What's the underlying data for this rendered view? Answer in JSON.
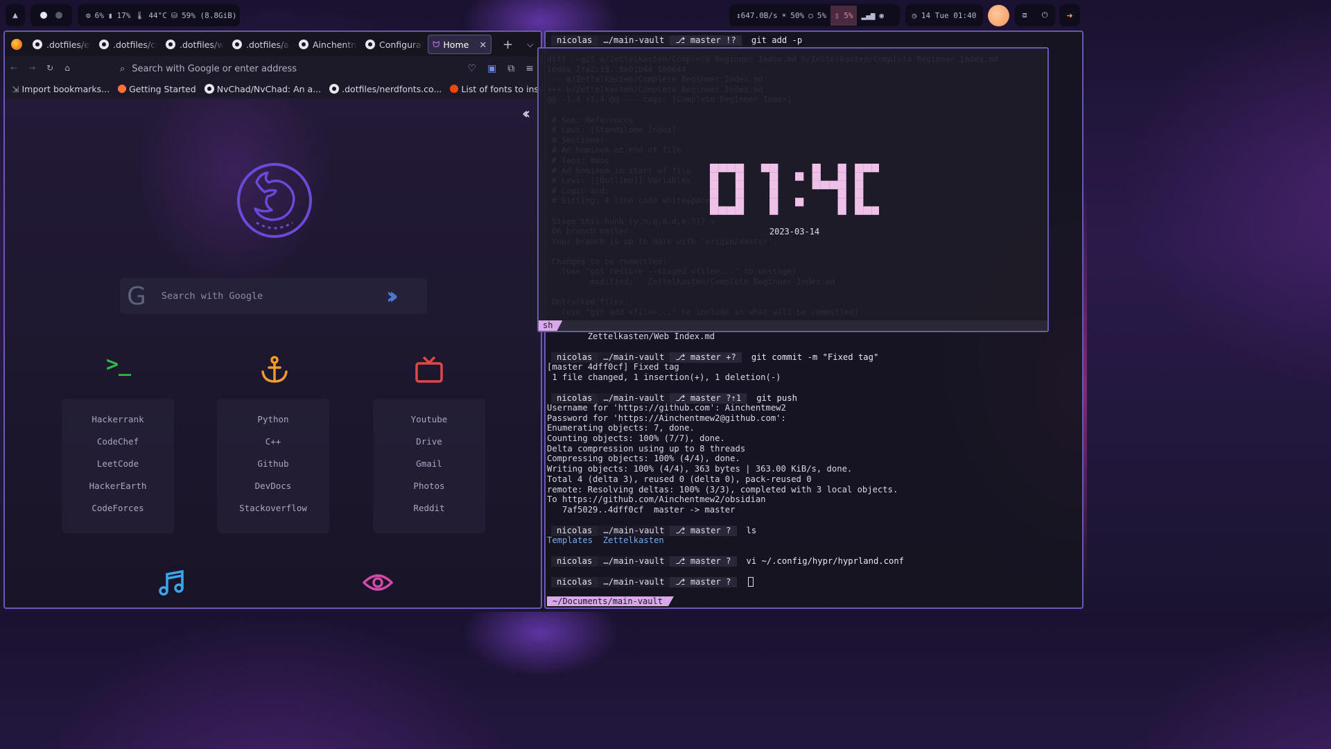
{
  "topbar": {
    "launcher": "▲",
    "stats": {
      "cpu": "6%",
      "mem": "17%",
      "temp": "44°C",
      "disk": "59% (8.8GiB)"
    },
    "net": {
      "speed": "↕647.0B/s",
      "brightness": "50%",
      "volume": "5%",
      "battery": "5%"
    },
    "clock": {
      "icon": "◷",
      "text": "14 Tue 01:40"
    }
  },
  "firefox": {
    "tabs": [
      {
        "label": ".dotfiles/ex"
      },
      {
        "label": ".dotfiles/co"
      },
      {
        "label": ".dotfiles/w"
      },
      {
        "label": ".dotfiles/au"
      },
      {
        "label": "Ainchentm"
      },
      {
        "label": "Configurat"
      }
    ],
    "active_tab": "Home",
    "url_placeholder": "Search with Google or enter address",
    "bookmarks": [
      {
        "label": "Import bookmarks...",
        "color": "#a0a0c0"
      },
      {
        "label": "Getting Started",
        "color": "#ff7139"
      },
      {
        "label": "NvChad/NvChad: An a...",
        "color": "#e8e8f0"
      },
      {
        "label": ".dotfiles/nerdfonts.co...",
        "color": "#e8e8f0"
      },
      {
        "label": "List of fonts to install s...",
        "color": "#ff4500"
      }
    ],
    "search_placeholder": "Search with Google",
    "columns": [
      {
        "icon": "terminal-icon",
        "color": "#2fb84a",
        "links": [
          "Hackerrank",
          "CodeChef",
          "LeetCode",
          "HackerEarth",
          "CodeForces"
        ]
      },
      {
        "icon": "anchor-icon",
        "color": "#f09a30",
        "links": [
          "Python",
          "C++",
          "Github",
          "DevDocs",
          "Stackoverflow"
        ]
      },
      {
        "icon": "tv-icon",
        "color": "#e04848",
        "links": [
          "Youtube",
          "Drive",
          "Gmail",
          "Photos",
          "Reddit"
        ]
      }
    ],
    "bottom_icons": [
      {
        "icon": "music-icon",
        "color": "#3aa8e8"
      },
      {
        "icon": "eye-icon",
        "color": "#d04aa8"
      }
    ]
  },
  "terminal": {
    "prompt": {
      "user": "nicolas",
      "path": "…/main-vault",
      "branch": "master"
    },
    "lines": [
      {
        "type": "prompt",
        "status": "!?",
        "cmd": "git add -p"
      },
      {
        "type": "text",
        "text": "        Zettelkasten/Web Index.md"
      },
      {
        "type": "blank"
      },
      {
        "type": "prompt",
        "status": "+?",
        "cmd": "git commit -m \"Fixed tag\""
      },
      {
        "type": "text",
        "text": "[master 4dff0cf] Fixed tag"
      },
      {
        "type": "text",
        "text": " 1 file changed, 1 insertion(+), 1 deletion(-)"
      },
      {
        "type": "blank"
      },
      {
        "type": "prompt",
        "status": "?⇡1",
        "cmd": "git push"
      },
      {
        "type": "text",
        "text": "Username for 'https://github.com': Ainchentmew2"
      },
      {
        "type": "text",
        "text": "Password for 'https://Ainchentmew2@github.com':"
      },
      {
        "type": "text",
        "text": "Enumerating objects: 7, done."
      },
      {
        "type": "text",
        "text": "Counting objects: 100% (7/7), done."
      },
      {
        "type": "text",
        "text": "Delta compression using up to 8 threads"
      },
      {
        "type": "text",
        "text": "Compressing objects: 100% (4/4), done."
      },
      {
        "type": "text",
        "text": "Writing objects: 100% (4/4), 363 bytes | 363.00 KiB/s, done."
      },
      {
        "type": "text",
        "text": "Total 4 (delta 3), reused 0 (delta 0), pack-reused 0"
      },
      {
        "type": "text",
        "text": "remote: Resolving deltas: 100% (3/3), completed with 3 local objects."
      },
      {
        "type": "text",
        "text": "To https://github.com/Ainchentmew2/obsidian"
      },
      {
        "type": "text",
        "text": "   7af5029..4dff0cf  master -> master"
      },
      {
        "type": "blank"
      },
      {
        "type": "prompt",
        "status": "?",
        "cmd": "ls"
      },
      {
        "type": "ls",
        "items": [
          "Templates",
          "Zettelkasten"
        ]
      },
      {
        "type": "blank"
      },
      {
        "type": "prompt",
        "status": "?",
        "cmd": "vi ~/.config/hypr/hyprland.conf"
      },
      {
        "type": "blank"
      },
      {
        "type": "prompt",
        "status": "?",
        "cmd": "",
        "cursor": true
      }
    ],
    "statusbar": "~/Documents/main-vault"
  },
  "clock_widget": {
    "time": "01:40",
    "date": "2023-03-14",
    "tab": "sh"
  },
  "colors": {
    "accent": "#6a5ab0",
    "clock_digits": "#efc0e8"
  }
}
